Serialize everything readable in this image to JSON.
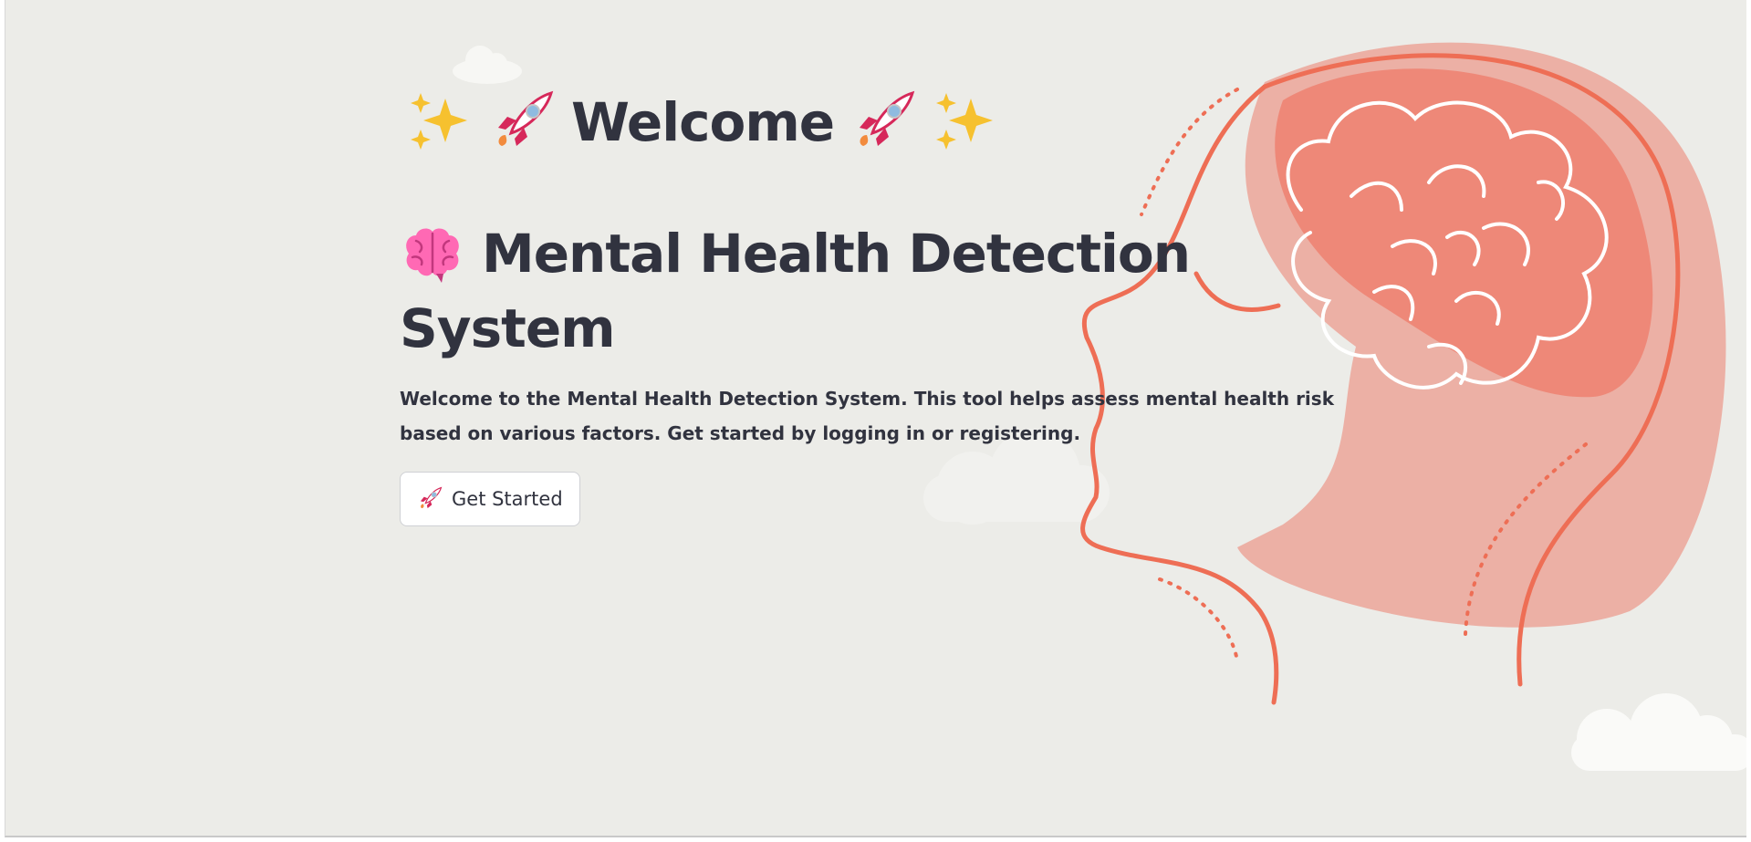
{
  "welcome": {
    "prefix_icons": [
      "sparkles-icon",
      "rocket-icon"
    ],
    "title": "Welcome",
    "suffix_icons": [
      "rocket-icon",
      "sparkles-icon"
    ]
  },
  "header": {
    "icon": "brain-icon",
    "title_line_1": "Mental Health Detection",
    "title_line_2": "System"
  },
  "description": "Welcome to the Mental Health Detection System. This tool helps assess mental health risk based on various factors. Get started by logging in or registering.",
  "cta": {
    "icon": "rocket-icon",
    "label": "Get Started"
  },
  "colors": {
    "background": "#ecece8",
    "text": "#31333f",
    "accent_coral": "#ee6e55",
    "head_fill": "#ecb0a5",
    "brain_fill": "#ee8878",
    "brain_icon": "#ff69b4",
    "sparkle": "#f6c12f",
    "rocket_red": "#d6285a"
  }
}
